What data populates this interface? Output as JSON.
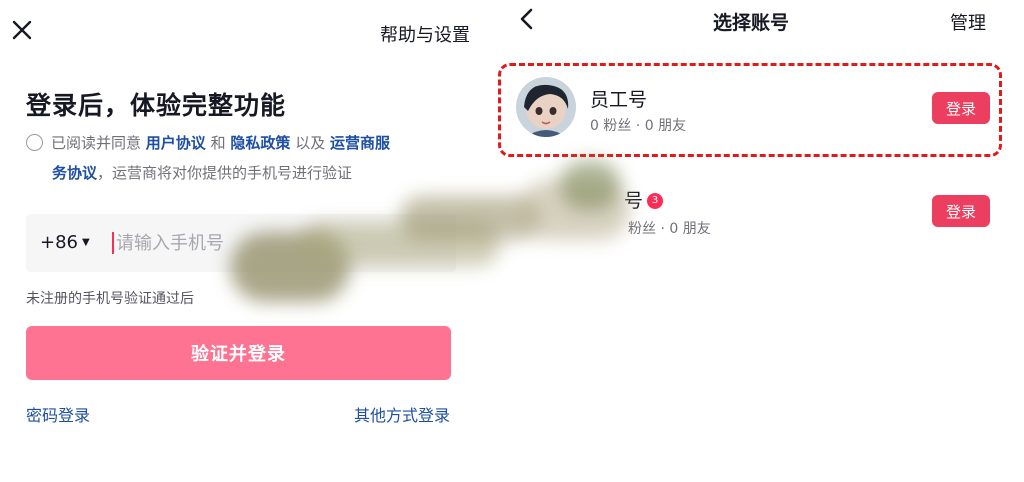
{
  "login": {
    "help_link": "帮助与设置",
    "title": "登录后，体验完整功能",
    "agree_prefix": "已阅读并同意",
    "user_agreement": "用户协议",
    "and": "和",
    "privacy_policy": "隐私政策",
    "and_also": "以及",
    "carrier_agreement_part1": "运营商服",
    "carrier_agreement_part2": "务协议",
    "agree_suffix": "，运营商将对你提供的手机号进行验证",
    "country_code": "+86",
    "phone_placeholder": "请输入手机号",
    "phone_value": "",
    "hint": "未注册的手机号验证通过后",
    "verify_login_button": "验证并登录",
    "password_login": "密码登录",
    "other_login": "其他方式登录"
  },
  "account_select": {
    "title": "选择账号",
    "manage": "管理",
    "accounts": [
      {
        "name": "员工号",
        "meta": "0 粉丝 · 0 朋友",
        "login_label": "登录"
      },
      {
        "name": "号",
        "badge": "3",
        "meta": "粉丝 · 0 朋友",
        "login_label": "登录"
      }
    ]
  },
  "colors": {
    "accent": "#fe2c55",
    "login_button": "#fe7391",
    "row_login": "#ec3f5f",
    "link": "#1e4fa3",
    "highlight": "#e21a1a"
  },
  "icons": {
    "close": "close-icon",
    "back": "back-arrow-icon",
    "dropdown": "caret-down-icon"
  }
}
